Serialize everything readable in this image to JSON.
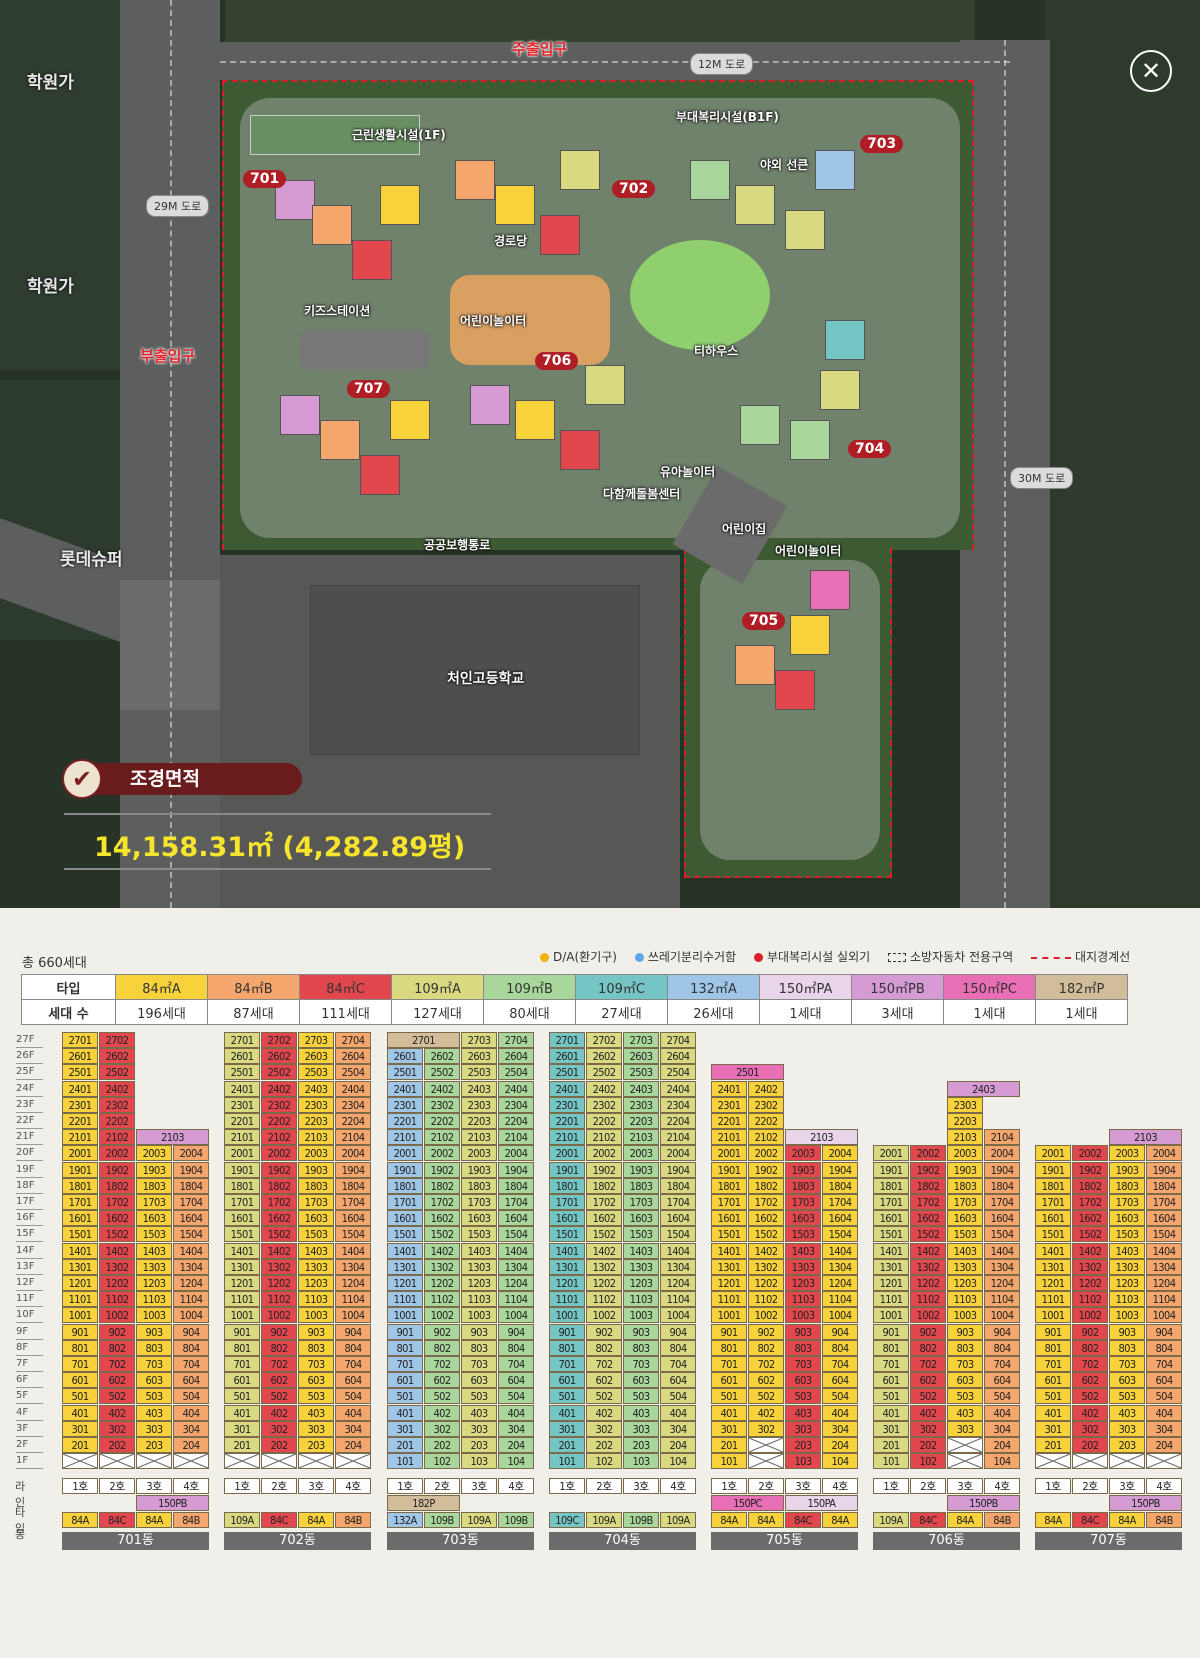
{
  "map": {
    "entrance_main": "주출입구",
    "entrance_side": "부출입구",
    "roads": {
      "r12": "12M 도로",
      "r29": "29M 도로",
      "r30": "30M 도로"
    },
    "areas": {
      "hagwon1": "학원가",
      "hagwon2": "학원가",
      "lotte": "롯데슈퍼",
      "school": "처인고등학교"
    },
    "facilities": {
      "neighborhood": "근린생활시설(1F)",
      "welfare": "부대복리시설(B1F)",
      "outdoor_lounge": "야외 선큰",
      "senior": "경로당",
      "kids_station": "키즈스테이션",
      "playground1": "어린이놀이터",
      "teahouse": "티하우스",
      "toddler_play": "유아놀이터",
      "childcare": "다함께돌봄센터",
      "daycare": "어린이집",
      "playground2": "어린이놀이터",
      "public_walk": "공공보행통로"
    },
    "buildings": [
      "701",
      "702",
      "703",
      "704",
      "705",
      "706",
      "707"
    ],
    "landscape_title": "조경면적",
    "landscape_area": "14,158.31㎡ (4,282.89평)"
  },
  "summary": {
    "total_households": "총 660세대",
    "legend": [
      "D/A(환기구)",
      "쓰레기분리수거함",
      "부대복리시설 실외기",
      "소방자동차 전용구역",
      "대지경계선"
    ],
    "row_type_label": "타입",
    "row_count_label": "세대 수",
    "types": [
      {
        "name": "84㎡A",
        "count": "196세대",
        "color": "#f7d23a"
      },
      {
        "name": "84㎡B",
        "count": "87세대",
        "color": "#f4a66d"
      },
      {
        "name": "84㎡C",
        "count": "111세대",
        "color": "#e2474d"
      },
      {
        "name": "109㎡A",
        "count": "127세대",
        "color": "#d9d982"
      },
      {
        "name": "109㎡B",
        "count": "80세대",
        "color": "#a9d69a"
      },
      {
        "name": "109㎡C",
        "count": "27세대",
        "color": "#76c5c5"
      },
      {
        "name": "132㎡A",
        "count": "26세대",
        "color": "#9fc6e7"
      },
      {
        "name": "150㎡PA",
        "count": "1세대",
        "color": "#e8d5ea"
      },
      {
        "name": "150㎡PB",
        "count": "3세대",
        "color": "#d59bd2"
      },
      {
        "name": "150㎡PC",
        "count": "1세대",
        "color": "#e86fb5"
      },
      {
        "name": "182㎡P",
        "count": "1세대",
        "color": "#d2bd9a"
      }
    ]
  },
  "dong_table": {
    "floors": [
      "27F",
      "26F",
      "25F",
      "24F",
      "23F",
      "22F",
      "21F",
      "20F",
      "19F",
      "18F",
      "17F",
      "16F",
      "15F",
      "14F",
      "13F",
      "12F",
      "11F",
      "10F",
      "9F",
      "8F",
      "7F",
      "6F",
      "5F",
      "4F",
      "3F",
      "2F",
      "1F"
    ],
    "row_labels": {
      "line": "라인",
      "type": "타입",
      "dong": "동"
    },
    "buildings": [
      {
        "name": "701동",
        "lines": [
          "1호",
          "2호",
          "3호",
          "4호"
        ],
        "types": [
          "84A",
          "84C",
          "84A",
          "84B"
        ],
        "special": "150PB"
      },
      {
        "name": "702동",
        "lines": [
          "1호",
          "2호",
          "3호",
          "4호"
        ],
        "types": [
          "109A",
          "84C",
          "84A",
          "84B"
        ],
        "special": ""
      },
      {
        "name": "703동",
        "lines": [
          "1호",
          "2호",
          "3호",
          "4호"
        ],
        "types": [
          "132A",
          "109B",
          "109A",
          "109B"
        ],
        "special": "182P"
      },
      {
        "name": "704동",
        "lines": [
          "1호",
          "2호",
          "3호",
          "4호"
        ],
        "types": [
          "109C",
          "109A",
          "109B",
          "109A"
        ],
        "special": ""
      },
      {
        "name": "705동",
        "lines": [
          "1호",
          "2호",
          "3호",
          "4호"
        ],
        "types": [
          "84A",
          "84A",
          "84C",
          "84A"
        ],
        "special": "150PC|150PA"
      },
      {
        "name": "706동",
        "lines": [
          "1호",
          "2호",
          "3호",
          "4호"
        ],
        "types": [
          "109A",
          "84C",
          "84A",
          "84B"
        ],
        "special": "150PB"
      },
      {
        "name": "707동",
        "lines": [
          "1호",
          "2호",
          "3호",
          "4호"
        ],
        "types": [
          "84A",
          "84C",
          "84A",
          "84B"
        ],
        "special": "150PB"
      }
    ]
  },
  "colors": {
    "border": "#d8202a",
    "title_bg": "#6a1b1b",
    "area_text": "#f6e52b"
  }
}
